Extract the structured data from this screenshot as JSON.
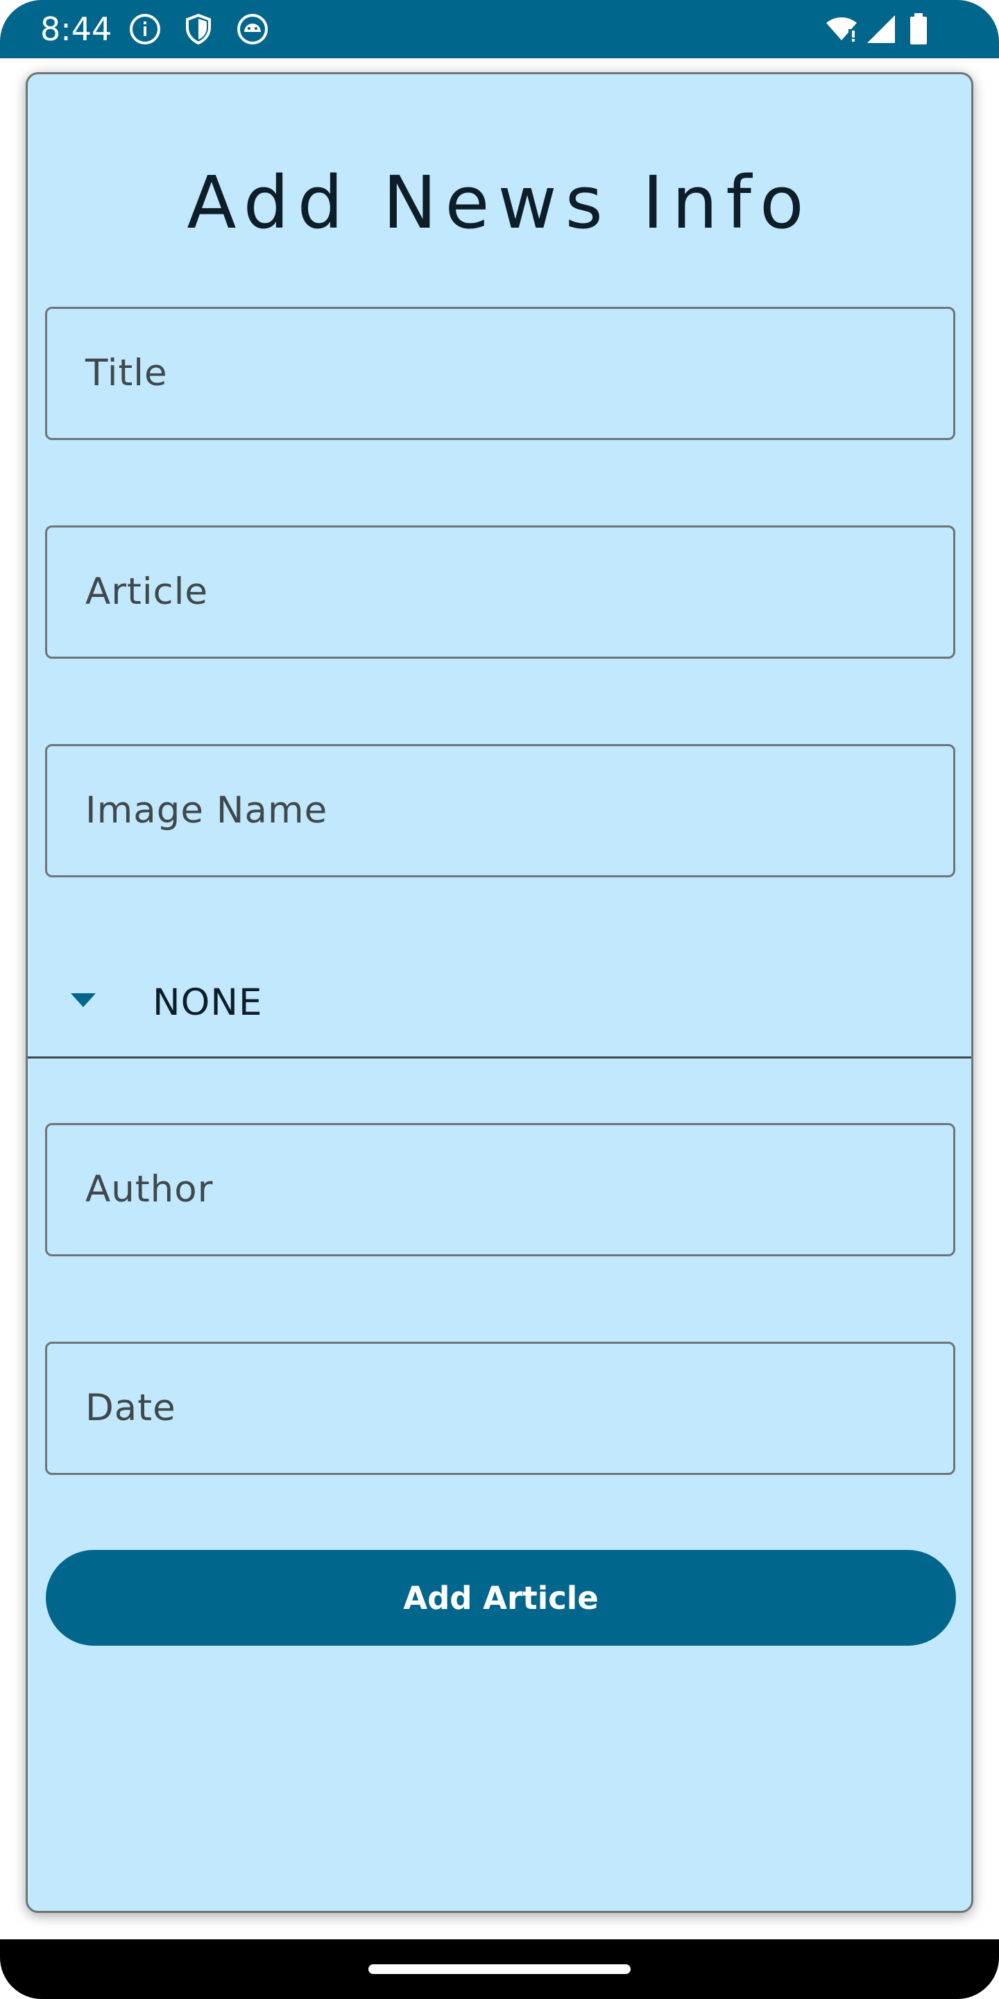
{
  "status_bar": {
    "time": "8:44",
    "left_icons": [
      "info-icon",
      "shield-icon",
      "android-debug-icon"
    ],
    "right_icons": [
      "wifi-icon",
      "cell-signal-icon",
      "battery-icon"
    ],
    "color": "#01668c"
  },
  "form": {
    "title": "Add News Info",
    "fields": {
      "title_label": "Title",
      "article_label": "Article",
      "image_name_label": "Image Name",
      "author_label": "Author",
      "date_label": "Date"
    },
    "dropdown": {
      "selected": "NONE",
      "icon": "arrow-drop-down-icon"
    },
    "submit_label": "Add Article"
  },
  "colors": {
    "primary": "#01668c",
    "card_background": "#c2e8fd",
    "outline": "#6f7478",
    "on_surface": "#0d1e28"
  }
}
